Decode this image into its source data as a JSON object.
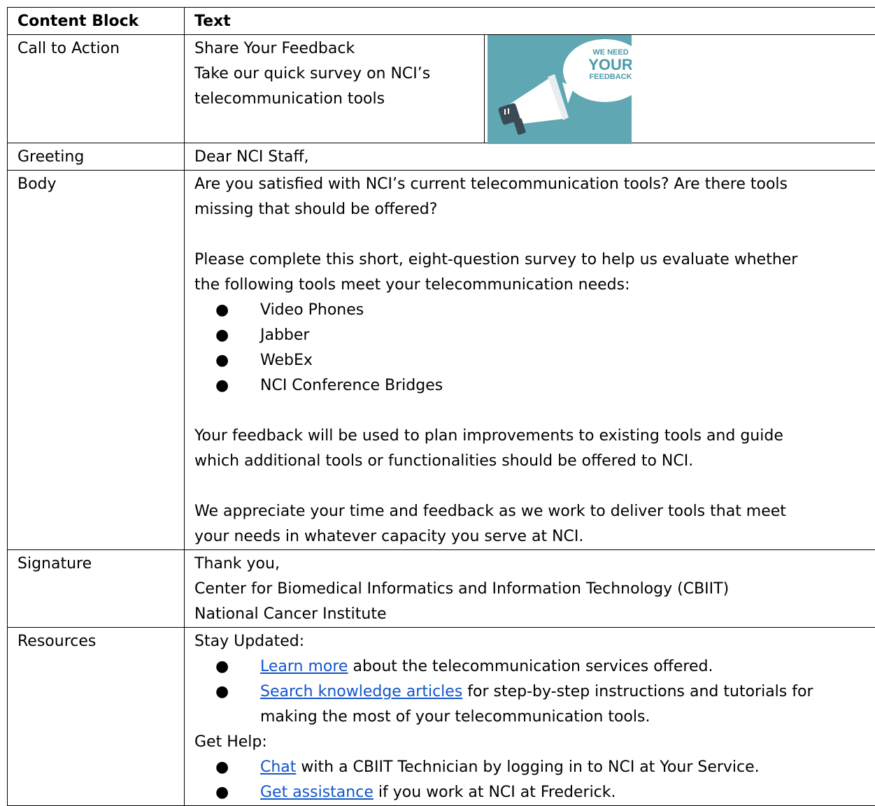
{
  "table": {
    "header": {
      "col1": "Content Block",
      "col2": "Text"
    },
    "cta": {
      "label": "Call to Action",
      "title": "Share Your Feedback",
      "line2": "Take our quick survey on NCI’s",
      "line3": "telecommunication tools",
      "image": {
        "we_need": "WE NEED",
        "your": "YOUR",
        "feedback": "FEEDBACK",
        "bg_color": "#5fa7b3",
        "text_color": "#4b9aa9"
      }
    },
    "greeting": {
      "label": "Greeting",
      "text": "Dear NCI Staff,"
    },
    "body": {
      "label": "Body",
      "p1_l1": "Are you satisfied with NCI’s current telecommunication tools? Are there tools",
      "p1_l2": "missing that should be offered?",
      "p2_l1": "Please complete this short, eight-question survey to help us evaluate whether",
      "p2_l2": "the following tools meet your telecommunication needs:",
      "tools": [
        "Video Phones",
        "Jabber",
        "WebEx",
        "NCI Conference Bridges"
      ],
      "p3_l1": "Your feedback will be used to plan improvements to existing tools and guide",
      "p3_l2": "which additional tools or functionalities should be offered to NCI.",
      "p4_l1": "We appreciate your time and feedback as we work to deliver tools that meet",
      "p4_l2": "your needs in whatever capacity you serve at NCI."
    },
    "signature": {
      "label": "Signature",
      "l1": "Thank you,",
      "l2": "Center for Biomedical Informatics and Information Technology (CBIIT)",
      "l3": "National Cancer Institute"
    },
    "resources": {
      "label": "Resources",
      "stay_updated": "Stay Updated:",
      "learn_more_link": "Learn more",
      "learn_more_rest": " about the telecommunication services offered.",
      "search_link": "Search knowledge articles",
      "search_rest": " for step-by-step instructions and tutorials for",
      "search_rest_l2": "making the most of your telecommunication tools.",
      "get_help": "Get Help:",
      "chat_link": "Chat",
      "chat_rest": " with a CBIIT Technician by logging in to NCI at Your Service.",
      "assist_link": "Get assistance",
      "assist_rest": " if you work at NCI at Frederick.",
      "link_color": "#1155cc"
    }
  }
}
